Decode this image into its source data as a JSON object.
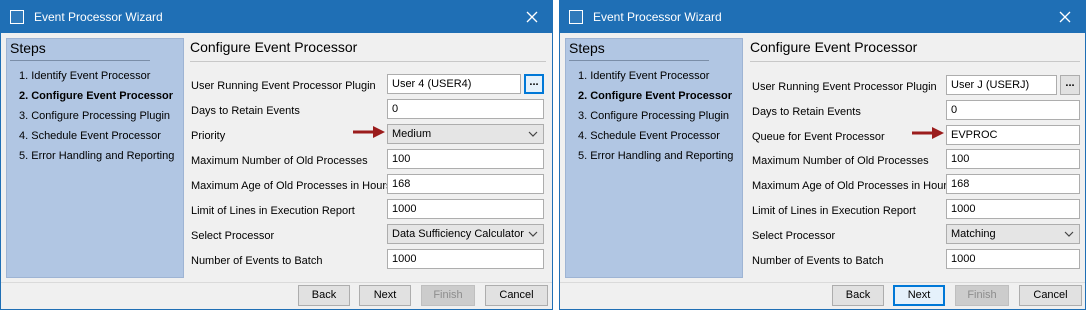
{
  "windows": [
    {
      "title": "Event Processor Wizard",
      "icon": "window-icon",
      "steps_title": "Steps",
      "steps": [
        {
          "label": "1. Identify Event Processor",
          "active": false
        },
        {
          "label": "2. Configure Event Processor",
          "active": true
        },
        {
          "label": "3. Configure Processing Plugin",
          "active": false
        },
        {
          "label": "4. Schedule Event Processor",
          "active": false
        },
        {
          "label": "5. Error Handling and Reporting",
          "active": false
        }
      ],
      "heading": "Configure Event Processor",
      "fields": [
        {
          "label": "User Running Event Processor Plugin",
          "value": "User 4 (USER4)",
          "type": "text-browse",
          "browse": "..."
        },
        {
          "label": "Days to Retain Events",
          "value": "0",
          "type": "text"
        },
        {
          "label": "Priority",
          "value": "Medium",
          "type": "select",
          "highlighted": true
        },
        {
          "label": "Maximum Number of Old Processes",
          "value": "100",
          "type": "text"
        },
        {
          "label": "Maximum Age of Old Processes in Hours",
          "value": "168",
          "type": "text"
        },
        {
          "label": "Limit of Lines in Execution Report",
          "value": "1000",
          "type": "text"
        },
        {
          "label": "Select Processor",
          "value": "Data Sufficiency Calculator",
          "type": "select"
        },
        {
          "label": "Number of Events to Batch",
          "value": "1000",
          "type": "text"
        }
      ],
      "buttons": {
        "back": "Back",
        "next": "Next",
        "finish": "Finish",
        "cancel": "Cancel"
      }
    },
    {
      "title": "Event Processor Wizard",
      "icon": "window-icon",
      "steps_title": "Steps",
      "steps": [
        {
          "label": "1. Identify Event Processor",
          "active": false
        },
        {
          "label": "2. Configure Event Processor",
          "active": true
        },
        {
          "label": "3. Configure Processing Plugin",
          "active": false
        },
        {
          "label": "4. Schedule Event Processor",
          "active": false
        },
        {
          "label": "5. Error Handling and Reporting",
          "active": false
        }
      ],
      "heading": "Configure Event Processor",
      "fields": [
        {
          "label": "User Running Event Processor Plugin",
          "value": "User J (USERJ)",
          "type": "text-browse",
          "browse": "..."
        },
        {
          "label": "Days to Retain Events",
          "value": "0",
          "type": "text"
        },
        {
          "label": "Queue for Event Processor",
          "value": "EVPROC",
          "type": "text",
          "highlighted": true
        },
        {
          "label": "Maximum Number of Old Processes",
          "value": "100",
          "type": "text"
        },
        {
          "label": "Maximum Age of Old Processes in Hours",
          "value": "168",
          "type": "text"
        },
        {
          "label": "Limit of Lines in Execution Report",
          "value": "1000",
          "type": "text"
        },
        {
          "label": "Select Processor",
          "value": "Matching",
          "type": "select"
        },
        {
          "label": "Number of Events to Batch",
          "value": "1000",
          "type": "text"
        }
      ],
      "buttons": {
        "back": "Back",
        "next": "Next",
        "finish": "Finish",
        "cancel": "Cancel"
      }
    }
  ],
  "colors": {
    "titlebar": "#1f6fb5",
    "steps_panel": "#b1c6e3",
    "annotation_arrow": "#9b1c1c"
  }
}
